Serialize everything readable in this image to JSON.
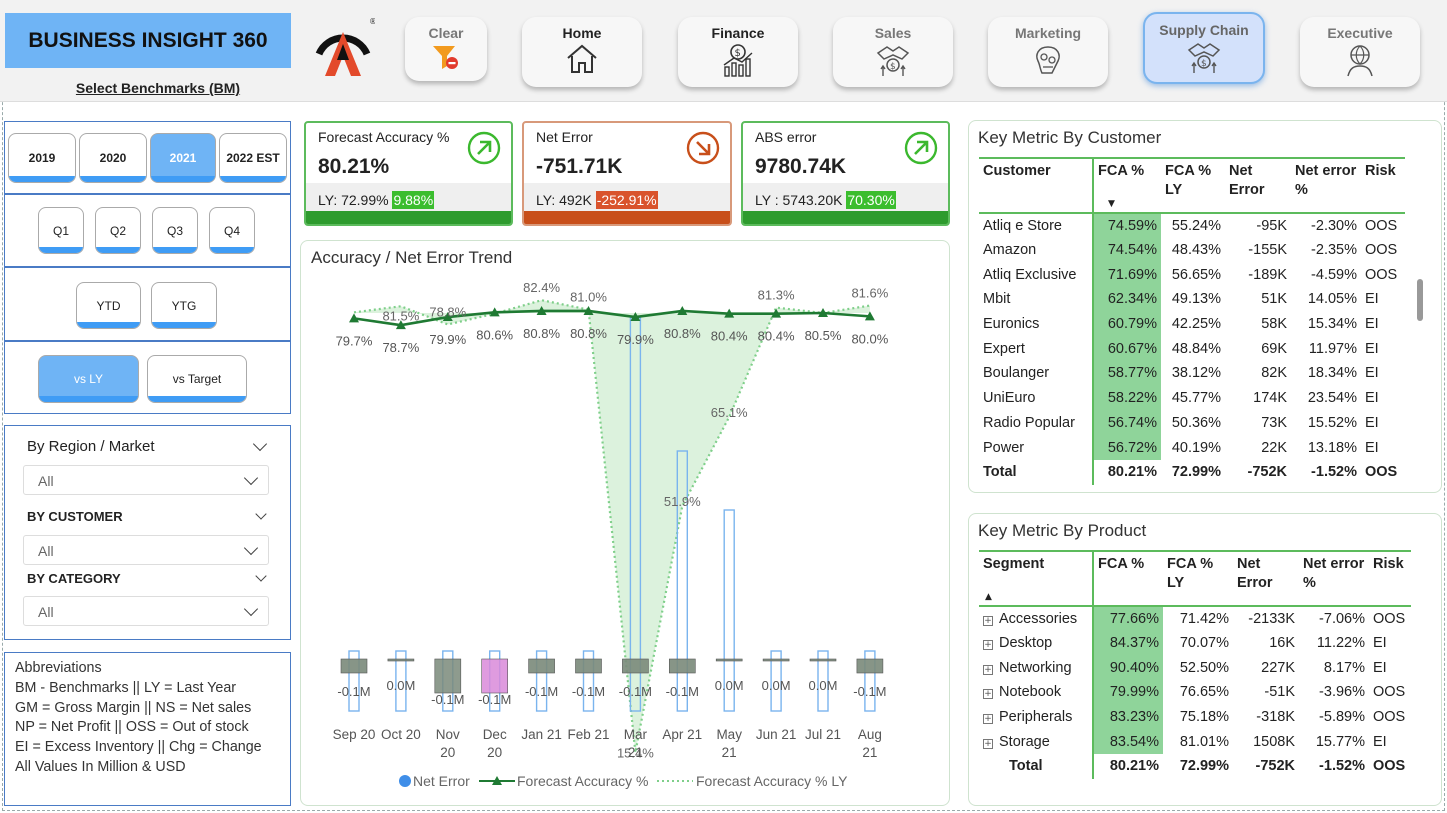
{
  "app": {
    "title": "BUSINESS INSIGHT 360",
    "benchmark_label": "Select Benchmarks (BM)"
  },
  "nav": [
    {
      "label": "Clear",
      "icon": "clear-filter-icon"
    },
    {
      "label": "Home",
      "icon": "home-icon"
    },
    {
      "label": "Finance",
      "icon": "finance-icon"
    },
    {
      "label": "Sales",
      "icon": "sales-icon"
    },
    {
      "label": "Marketing",
      "icon": "marketing-icon"
    },
    {
      "label": "Supply Chain",
      "icon": "supply-chain-icon",
      "selected": true
    },
    {
      "label": "Executive",
      "icon": "executive-icon"
    }
  ],
  "filters": {
    "years": [
      "2019",
      "2020",
      "2021",
      "2022 EST"
    ],
    "selected_year": "2021",
    "quarters": [
      "Q1",
      "Q2",
      "Q3",
      "Q4"
    ],
    "periods": [
      "YTD",
      "YTG"
    ],
    "compare": [
      "vs LY",
      "vs Target"
    ],
    "selected_compare": "vs LY",
    "region_label": "By Region / Market",
    "region_value": "All",
    "customer_label": "BY CUSTOMER",
    "customer_value": "All",
    "category_label": "BY CATEGORY",
    "category_value": "All"
  },
  "abbreviations": [
    "Abbreviations",
    "BM - Benchmarks ||  LY = Last Year",
    "GM = Gross Margin || NS = Net sales",
    "NP = Net Profit || OSS = Out of stock",
    "EI = Excess Inventory || Chg = Change",
    "All Values In Million & USD"
  ],
  "kpis": [
    {
      "title": "Forecast Accuracy %",
      "value": "80.21%",
      "ly": "LY: 72.99%",
      "chg": "9.88%",
      "trend": "up",
      "color": "#2e9b2e"
    },
    {
      "title": "Net Error",
      "value": "-751.71K",
      "ly": "LY: 492K",
      "chg": "-252.91%",
      "trend": "down",
      "color": "#c84f1a"
    },
    {
      "title": "ABS error",
      "value": "9780.74K",
      "ly": "LY : 5743.20K",
      "chg": "70.30%",
      "trend": "up",
      "color": "#2e9b2e"
    }
  ],
  "trend": {
    "title": "Accuracy / Net Error Trend",
    "legend": [
      "Net Error",
      "Forecast Accuracy %",
      "Forecast Accuracy % LY"
    ]
  },
  "chart_data": {
    "type": "line",
    "title": "Accuracy / Net Error Trend",
    "categories": [
      "Sep 20",
      "Oct 20",
      "Nov 20",
      "Dec 20",
      "Jan 21",
      "Feb 21",
      "Mar 21",
      "Apr 21",
      "May 21",
      "Jun 21",
      "Jul 21",
      "Aug 21"
    ],
    "series": [
      {
        "name": "Forecast Accuracy %",
        "type": "line",
        "values": [
          79.7,
          78.7,
          79.9,
          80.6,
          80.8,
          80.8,
          79.9,
          80.8,
          80.4,
          80.4,
          80.5,
          80.0
        ],
        "labels": [
          "79.7%",
          "78.7%",
          "79.9%",
          "80.6%",
          "80.8%",
          "80.8%",
          "79.9%",
          "80.8%",
          "80.4%",
          "80.4%",
          "80.5%",
          "80.0%"
        ]
      },
      {
        "name": "Forecast Accuracy % LY",
        "type": "area",
        "values": [
          80.6,
          81.5,
          78.8,
          80.4,
          82.4,
          81.0,
          15.4,
          51.9,
          65.1,
          81.3,
          80.5,
          81.6
        ],
        "labels": [
          "",
          "81.5%",
          "78.8%",
          "",
          "82.4%",
          "81.0%",
          "15.4%",
          "51.9%",
          "65.1%",
          "81.3%",
          "",
          "81.6%"
        ]
      },
      {
        "name": "Net Error",
        "type": "bar",
        "values": [
          -0.1,
          0.0,
          -0.1,
          -0.1,
          -0.1,
          -0.1,
          -0.1,
          -0.1,
          0.0,
          0.0,
          0.0,
          -0.1
        ],
        "labels": [
          "-0.1M",
          "0.0M",
          "-0.1M",
          "-0.1M",
          "-0.1M",
          "-0.1M",
          "-0.1M",
          "-0.1M",
          "0.0M",
          "0.0M",
          "0.0M",
          "-0.1M"
        ]
      }
    ],
    "ly_net_error_bars_tall_at": [
      "Mar 21",
      "Apr 21",
      "May 21"
    ],
    "colors": {
      "fa": "#1f7a33",
      "ly": "#7fcf8a",
      "net_pos": "#7a8a7a",
      "net_dec": "#d98ad9",
      "ly_bar": "#7ab4ee"
    }
  },
  "customer_table": {
    "title": "Key Metric By Customer",
    "headers": [
      "Customer",
      "FCA %",
      "FCA % LY",
      "Net Error",
      "Net error %",
      "Risk"
    ],
    "rows": [
      [
        "Atliq e Store",
        "74.59%",
        "55.24%",
        "-95K",
        "-2.30%",
        "OOS"
      ],
      [
        "Amazon",
        "74.54%",
        "48.43%",
        "-155K",
        "-2.35%",
        "OOS"
      ],
      [
        "Atliq Exclusive",
        "71.69%",
        "56.65%",
        "-189K",
        "-4.59%",
        "OOS"
      ],
      [
        "Mbit",
        "62.34%",
        "49.13%",
        "51K",
        "14.05%",
        "EI"
      ],
      [
        "Euronics",
        "60.79%",
        "42.25%",
        "58K",
        "15.34%",
        "EI"
      ],
      [
        "Expert",
        "60.67%",
        "48.84%",
        "69K",
        "11.97%",
        "EI"
      ],
      [
        "Boulanger",
        "58.77%",
        "38.12%",
        "82K",
        "18.34%",
        "EI"
      ],
      [
        "UniEuro",
        "58.22%",
        "45.77%",
        "174K",
        "23.54%",
        "EI"
      ],
      [
        "Radio Popular",
        "56.74%",
        "50.36%",
        "73K",
        "15.52%",
        "EI"
      ],
      [
        "Power",
        "56.72%",
        "40.19%",
        "22K",
        "13.18%",
        "EI"
      ]
    ],
    "total": [
      "Total",
      "80.21%",
      "72.99%",
      "-752K",
      "-1.52%",
      "OOS"
    ]
  },
  "product_table": {
    "title": "Key Metric By Product",
    "headers": [
      "Segment",
      "FCA %",
      "FCA % LY",
      "Net Error",
      "Net error %",
      "Risk"
    ],
    "rows": [
      [
        "Accessories",
        "77.66%",
        "71.42%",
        "-2133K",
        "-7.06%",
        "OOS"
      ],
      [
        "Desktop",
        "84.37%",
        "70.07%",
        "16K",
        "11.22%",
        "EI"
      ],
      [
        "Networking",
        "90.40%",
        "52.50%",
        "227K",
        "8.17%",
        "EI"
      ],
      [
        "Notebook",
        "79.99%",
        "76.65%",
        "-51K",
        "-3.96%",
        "OOS"
      ],
      [
        "Peripherals",
        "83.23%",
        "75.18%",
        "-318K",
        "-5.89%",
        "OOS"
      ],
      [
        "Storage",
        "83.54%",
        "81.01%",
        "1508K",
        "15.77%",
        "EI"
      ]
    ],
    "total": [
      "Total",
      "80.21%",
      "72.99%",
      "-752K",
      "-1.52%",
      "OOS"
    ]
  }
}
